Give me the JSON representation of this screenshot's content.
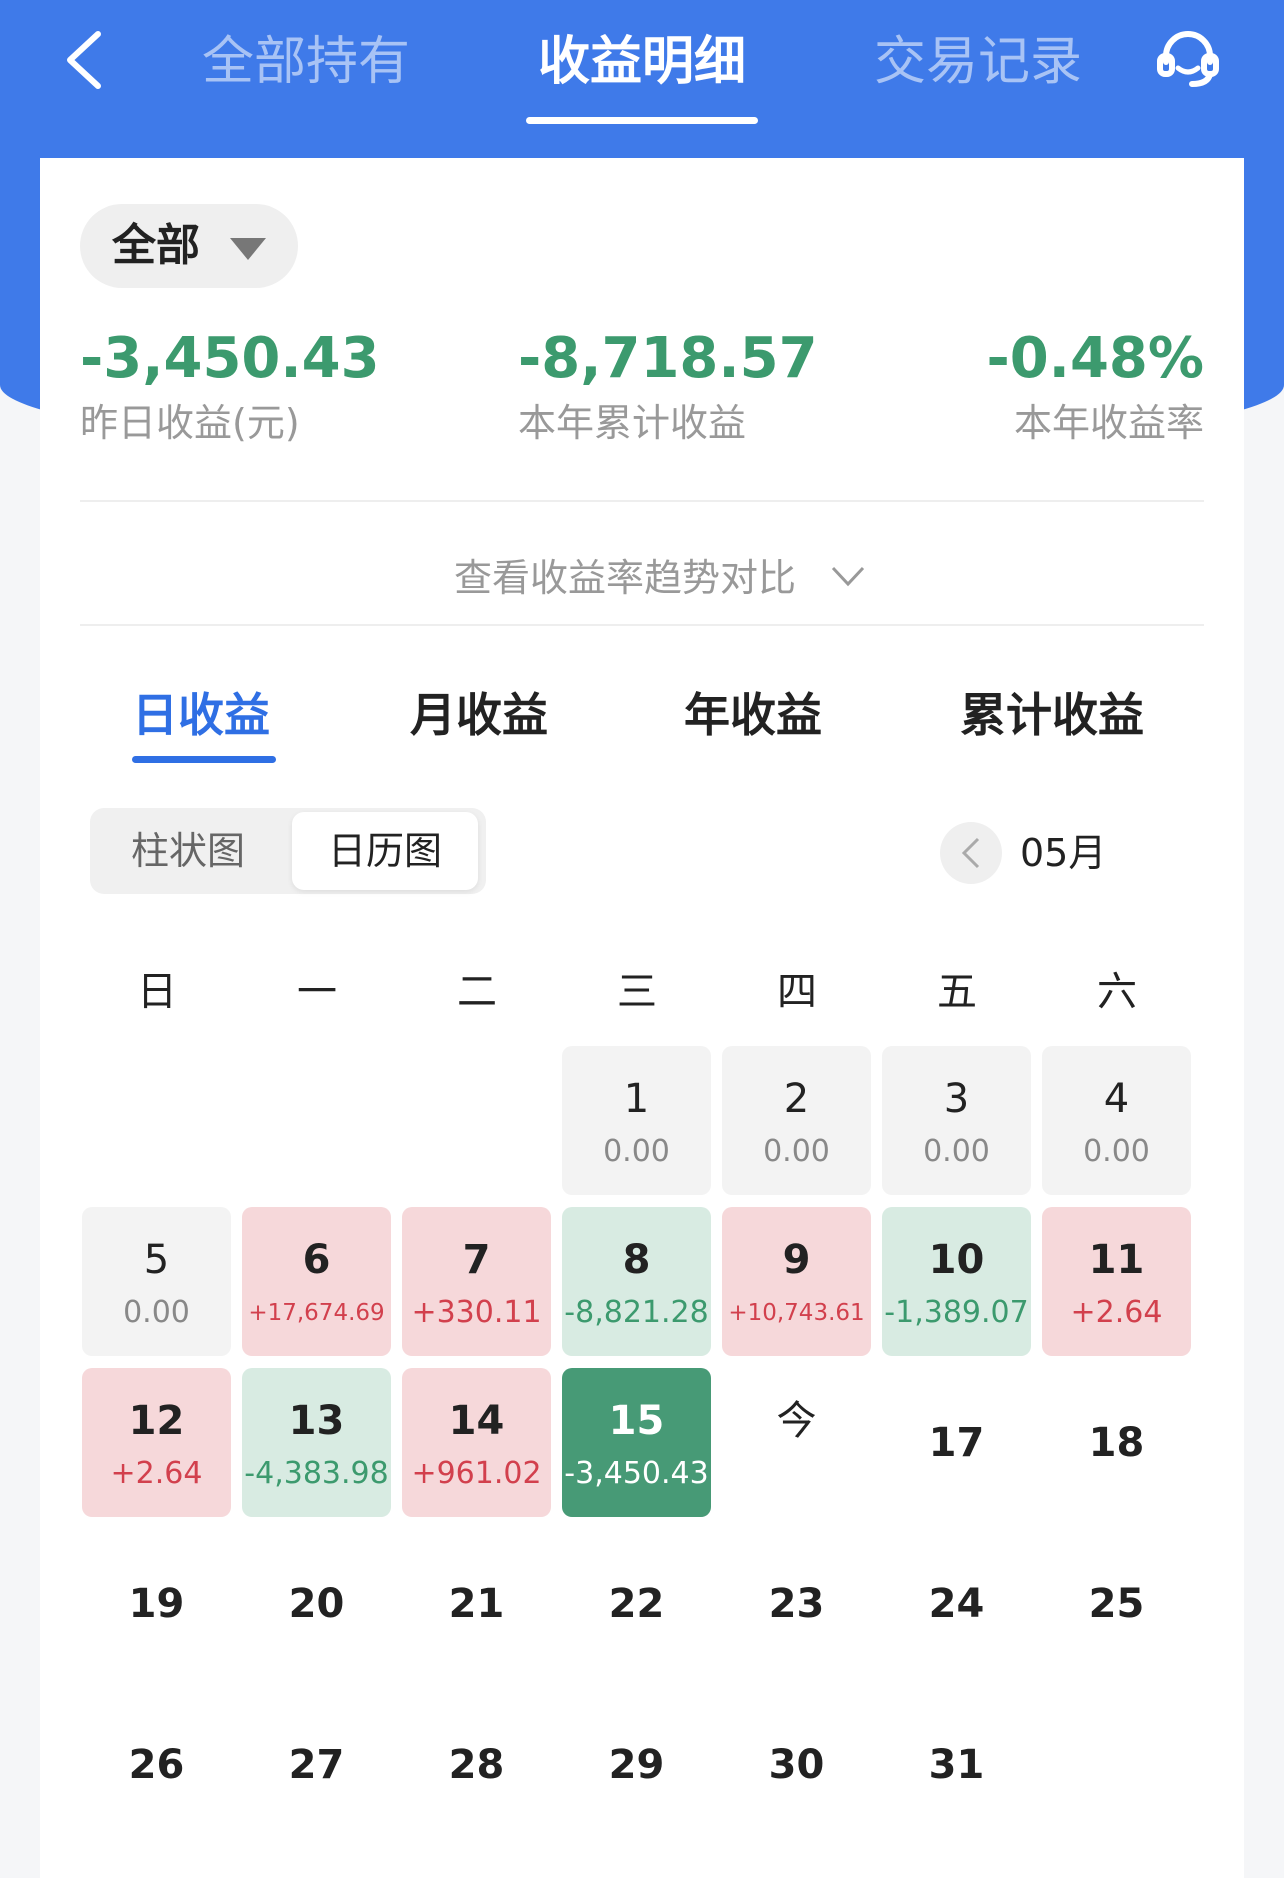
{
  "nav": {
    "tabs": [
      "全部持有",
      "收益明细",
      "交易记录"
    ],
    "active_tab": "收益明细"
  },
  "filter": {
    "label": "全部"
  },
  "stats": [
    {
      "value": "-3,450.43",
      "label": "昨日收益(元)"
    },
    {
      "value": "-8,718.57",
      "label": "本年累计收益"
    },
    {
      "value": "-0.48%",
      "label": "本年收益率"
    }
  ],
  "trend_link": "查看收益率趋势对比",
  "period_tabs": [
    "日收益",
    "月收益",
    "年收益",
    "累计收益"
  ],
  "view_toggle": {
    "options": [
      "柱状图",
      "日历图"
    ],
    "selected": "日历图"
  },
  "month": "05月",
  "weekdays": [
    "日",
    "一",
    "二",
    "三",
    "四",
    "五",
    "六"
  ],
  "calendar": [
    {
      "day": "1",
      "value": "0.00",
      "type": "zero"
    },
    {
      "day": "2",
      "value": "0.00",
      "type": "zero"
    },
    {
      "day": "3",
      "value": "0.00",
      "type": "zero"
    },
    {
      "day": "4",
      "value": "0.00",
      "type": "zero"
    },
    {
      "day": "5",
      "value": "0.00",
      "type": "zero"
    },
    {
      "day": "6",
      "value": "+17,674.69",
      "type": "pos"
    },
    {
      "day": "7",
      "value": "+330.11",
      "type": "pos"
    },
    {
      "day": "8",
      "value": "-8,821.28",
      "type": "neg"
    },
    {
      "day": "9",
      "value": "+10,743.61",
      "type": "pos"
    },
    {
      "day": "10",
      "value": "-1,389.07",
      "type": "neg"
    },
    {
      "day": "11",
      "value": "+2.64",
      "type": "pos"
    },
    {
      "day": "12",
      "value": "+2.64",
      "type": "pos"
    },
    {
      "day": "13",
      "value": "-4,383.98",
      "type": "neg"
    },
    {
      "day": "14",
      "value": "+961.02",
      "type": "pos"
    },
    {
      "day": "15",
      "value": "-3,450.43",
      "type": "cur"
    },
    {
      "day": "今",
      "value": "",
      "type": "today"
    },
    {
      "day": "17",
      "value": "",
      "type": "plain"
    },
    {
      "day": "18",
      "value": "",
      "type": "plain"
    },
    {
      "day": "19",
      "value": "",
      "type": "plain"
    },
    {
      "day": "20",
      "value": "",
      "type": "plain"
    },
    {
      "day": "21",
      "value": "",
      "type": "plain"
    },
    {
      "day": "22",
      "value": "",
      "type": "plain"
    },
    {
      "day": "23",
      "value": "",
      "type": "plain"
    },
    {
      "day": "24",
      "value": "",
      "type": "plain"
    },
    {
      "day": "25",
      "value": "",
      "type": "plain"
    },
    {
      "day": "26",
      "value": "",
      "type": "plain"
    },
    {
      "day": "27",
      "value": "",
      "type": "plain"
    },
    {
      "day": "28",
      "value": "",
      "type": "plain"
    },
    {
      "day": "29",
      "value": "",
      "type": "plain"
    },
    {
      "day": "30",
      "value": "",
      "type": "plain"
    },
    {
      "day": "31",
      "value": "",
      "type": "plain"
    }
  ],
  "colors": {
    "brand_blue": "#3f7ae9",
    "gain_red": "#d2404d",
    "loss_green": "#3c9a6e",
    "active_tab_blue": "#2f6fe4"
  },
  "icons": [
    "back-arrow-icon",
    "customer-service-icon",
    "caret-down-icon",
    "chevron-down-icon",
    "chevron-left-icon"
  ]
}
